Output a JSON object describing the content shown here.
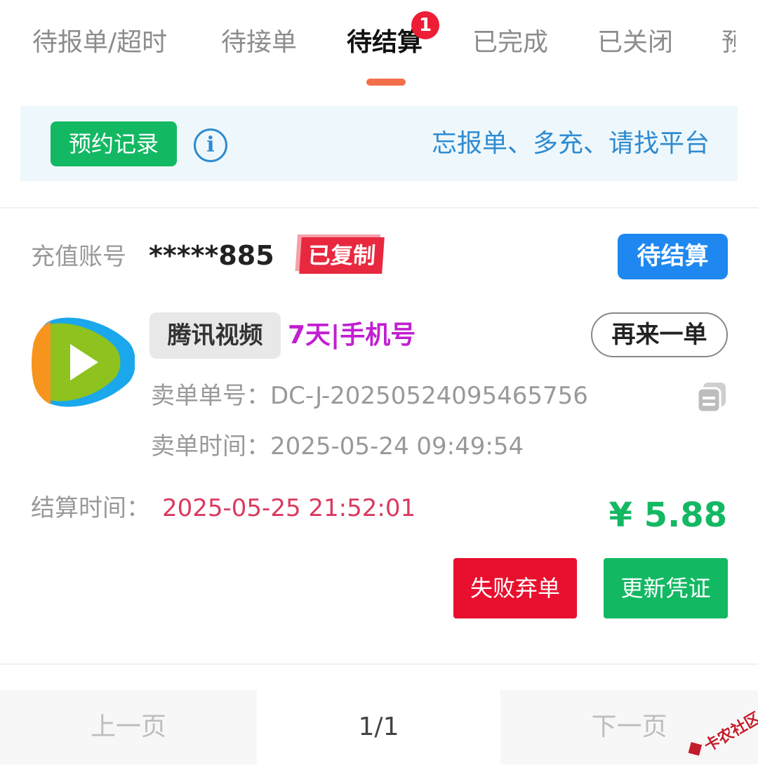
{
  "tabs": [
    {
      "label": "待报单/超时"
    },
    {
      "label": "待接单"
    },
    {
      "label": "待结算",
      "badge": "1",
      "active": true
    },
    {
      "label": "已完成"
    },
    {
      "label": "已关闭"
    },
    {
      "label": "预"
    }
  ],
  "notice": {
    "button_label": "预约记录",
    "info_icon": "info-circle-icon",
    "text": "忘报单、多充、请找平台"
  },
  "order": {
    "account_label": "充值账号",
    "account_value": "*****885",
    "copied_tag": "已复制",
    "status": "待结算",
    "app_icon": "tencent-video-logo-icon",
    "product_name": "腾讯视频",
    "product_spec": "7天|手机号",
    "reorder_label": "再来一单",
    "order_no_label": "卖单单号：",
    "order_no_value": "DC-J-20250524095465756",
    "copy_icon": "copy-icon",
    "order_time_label": "卖单时间：",
    "order_time_value": "2025-05-24 09:49:54",
    "settle_time_label": "结算时间：",
    "settle_time_value": "2025-05-25 21:52:01",
    "price": "¥ 5.88",
    "abandon_label": "失败弃单",
    "update_label": "更新凭证"
  },
  "pager": {
    "prev_label": "上一页",
    "page_indicator": "1/1",
    "next_label": "下一页"
  },
  "watermark": {
    "text": "卡农社区"
  },
  "colors": {
    "accent_orange": "#f26f4a",
    "green": "#13b863",
    "blue": "#1e88f0",
    "red": "#e8102e",
    "notice_bg": "#eef8fc",
    "notice_text": "#2f8bd0",
    "spec_purple": "#c11fd1",
    "settle_time_red": "#d93a5e"
  }
}
